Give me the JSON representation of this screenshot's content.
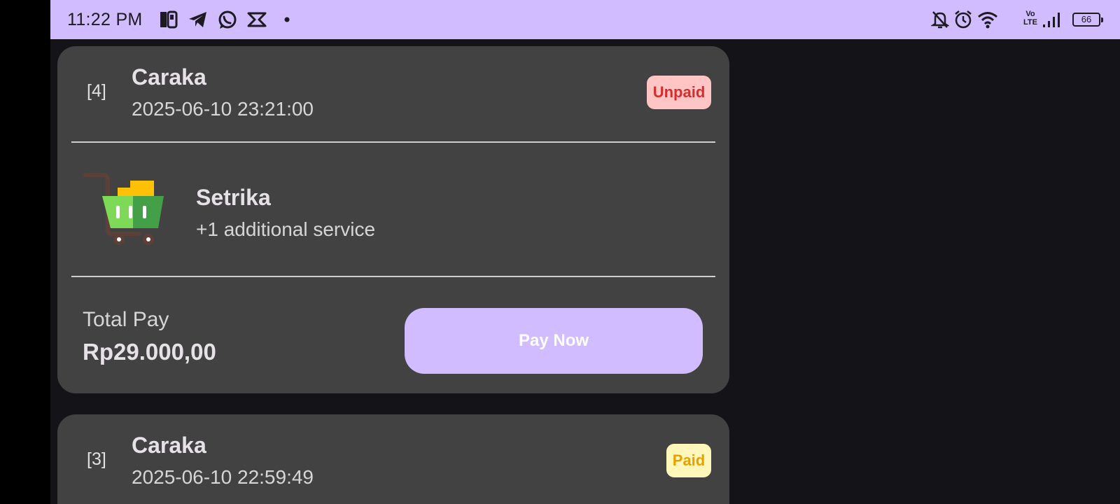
{
  "status_bar": {
    "time": "11:22 PM",
    "left_icons": [
      "p-app-icon",
      "telegram-icon",
      "whatsapp-icon",
      "capcut-icon",
      "notification-dot-icon"
    ],
    "right_icons": [
      "mute-bell-icon",
      "alarm-icon",
      "wifi-icon",
      "volte-icon",
      "signal-icon",
      "battery-icon"
    ],
    "volte_top": "Vo",
    "volte_bottom": "LTE",
    "battery": "66"
  },
  "orders": [
    {
      "number": "[4]",
      "customer": "Caraka",
      "datetime": "2025-06-10 23:21:00",
      "status": "Unpaid",
      "status_color": "#d32f2f",
      "service_icon": "shopping-cart-icon",
      "service": "Setrika",
      "additional": "+1 additional service",
      "total_label": "Total Pay",
      "total_value": "Rp29.000,00",
      "action_label": "Pay Now"
    },
    {
      "number": "[3]",
      "customer": "Caraka",
      "datetime": "2025-06-10 22:59:49",
      "status": "Paid",
      "status_color": "#e6a100"
    }
  ],
  "colors": {
    "accent": "#d0bcff",
    "background": "#141317",
    "card": "#424242"
  }
}
